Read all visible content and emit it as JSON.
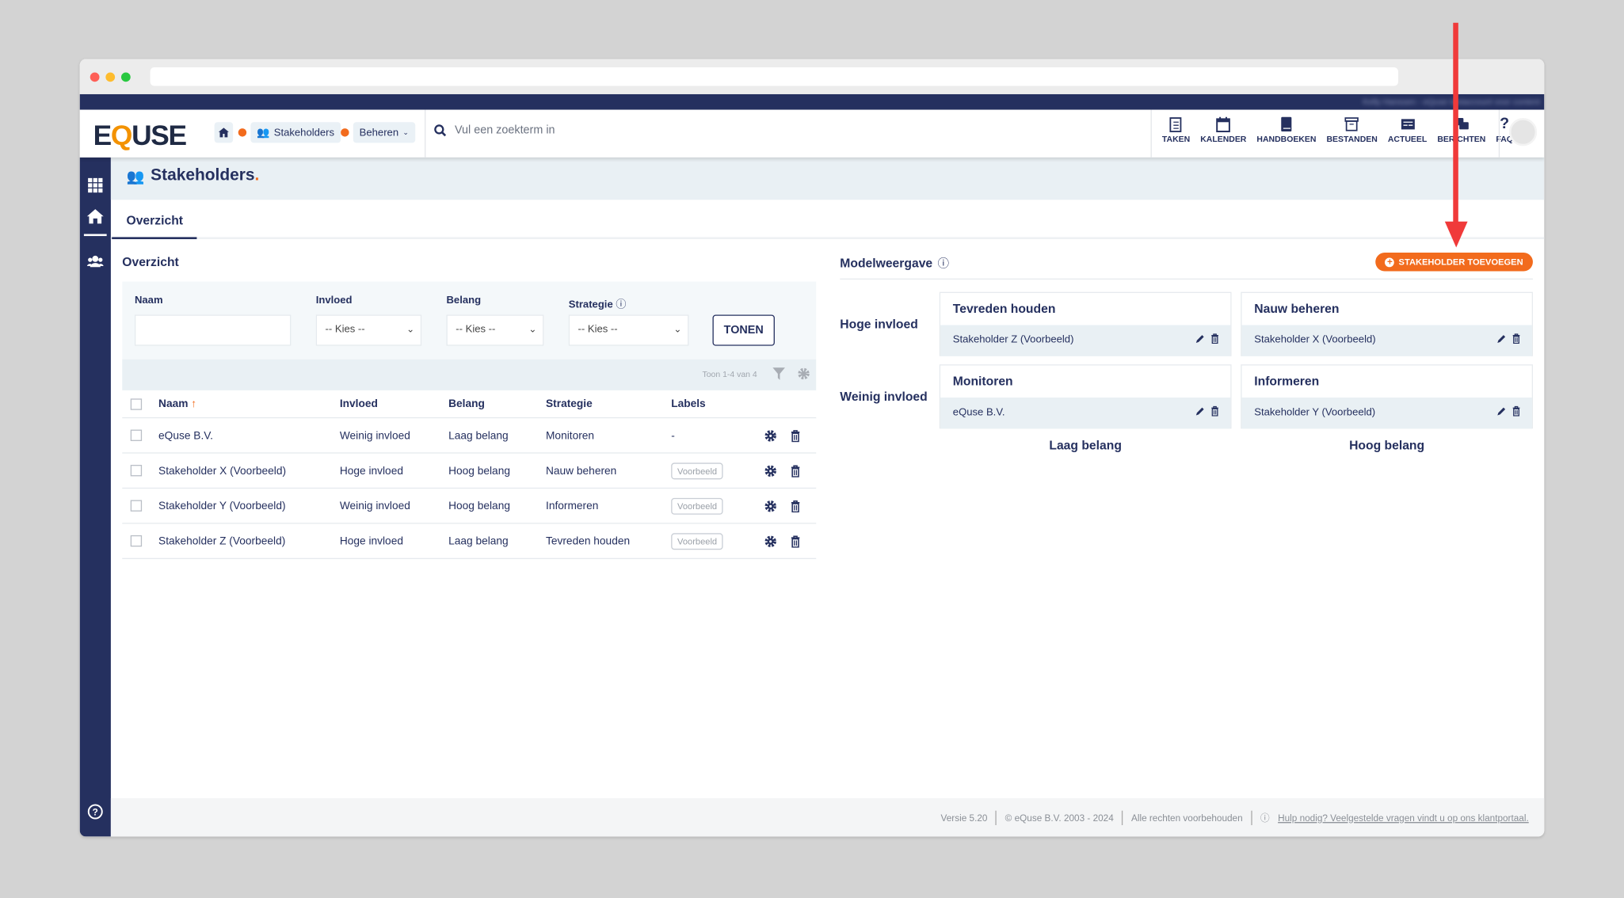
{
  "header": {
    "logo": "EQUSE",
    "breadcrumb": {
      "stakeholders": "Stakeholders",
      "beheren": "Beheren"
    },
    "search_placeholder": "Vul een zoekterm in",
    "blurred_user": "Kelly Hanssen - eQuse testaccount voor content",
    "nav": [
      {
        "label": "TAKEN",
        "icon": "clipboard-icon"
      },
      {
        "label": "KALENDER",
        "icon": "calendar-icon"
      },
      {
        "label": "HANDBOEKEN",
        "icon": "book-icon"
      },
      {
        "label": "BESTANDEN",
        "icon": "archive-icon"
      },
      {
        "label": "ACTUEEL",
        "icon": "newspaper-icon"
      },
      {
        "label": "BERICHTEN",
        "icon": "comments-icon"
      },
      {
        "label": "FAQ",
        "icon": "question-icon"
      }
    ]
  },
  "page": {
    "title": "Stakeholders",
    "tab": "Overzicht"
  },
  "overview": {
    "title": "Overzicht",
    "filters": {
      "naam_label": "Naam",
      "naam_value": "",
      "invloed_label": "Invloed",
      "belang_label": "Belang",
      "strategie_label": "Strategie",
      "select_value": "-- Kies --",
      "button": "TONEN"
    },
    "count_text": "Toon 1-4 van 4",
    "columns": [
      "Naam",
      "Invloed",
      "Belang",
      "Strategie",
      "Labels"
    ],
    "rows": [
      {
        "naam": "eQuse B.V.",
        "invloed": "Weinig invloed",
        "belang": "Laag belang",
        "strategie": "Monitoren",
        "label": "-"
      },
      {
        "naam": "Stakeholder X (Voorbeeld)",
        "invloed": "Hoge invloed",
        "belang": "Hoog belang",
        "strategie": "Nauw beheren",
        "label": "Voorbeeld"
      },
      {
        "naam": "Stakeholder Y (Voorbeeld)",
        "invloed": "Weinig invloed",
        "belang": "Hoog belang",
        "strategie": "Informeren",
        "label": "Voorbeeld"
      },
      {
        "naam": "Stakeholder Z (Voorbeeld)",
        "invloed": "Hoge invloed",
        "belang": "Laag belang",
        "strategie": "Tevreden houden",
        "label": "Voorbeeld"
      }
    ]
  },
  "model": {
    "title": "Modelweergave",
    "add_button": "STAKEHOLDER TOEVOEGEN",
    "row_labels": [
      "Hoge invloed",
      "Weinig invloed"
    ],
    "col_labels": [
      "Laag belang",
      "Hoog belang"
    ],
    "cards": [
      {
        "title": "Tevreden houden",
        "item": "Stakeholder Z (Voorbeeld)"
      },
      {
        "title": "Nauw beheren",
        "item": "Stakeholder X (Voorbeeld)"
      },
      {
        "title": "Monitoren",
        "item": "eQuse B.V."
      },
      {
        "title": "Informeren",
        "item": "Stakeholder Y (Voorbeeld)"
      }
    ]
  },
  "footer": {
    "version": "Versie 5.20",
    "copyright": "© eQuse B.V. 2003 - 2024",
    "rights": "Alle rechten voorbehouden",
    "help": "Hulp nodig? Veelgestelde vragen vindt u op ons klantportaal."
  },
  "colors": {
    "navy": "#25305f",
    "orange": "#f26b1d",
    "annotation": "#f03a3a"
  }
}
